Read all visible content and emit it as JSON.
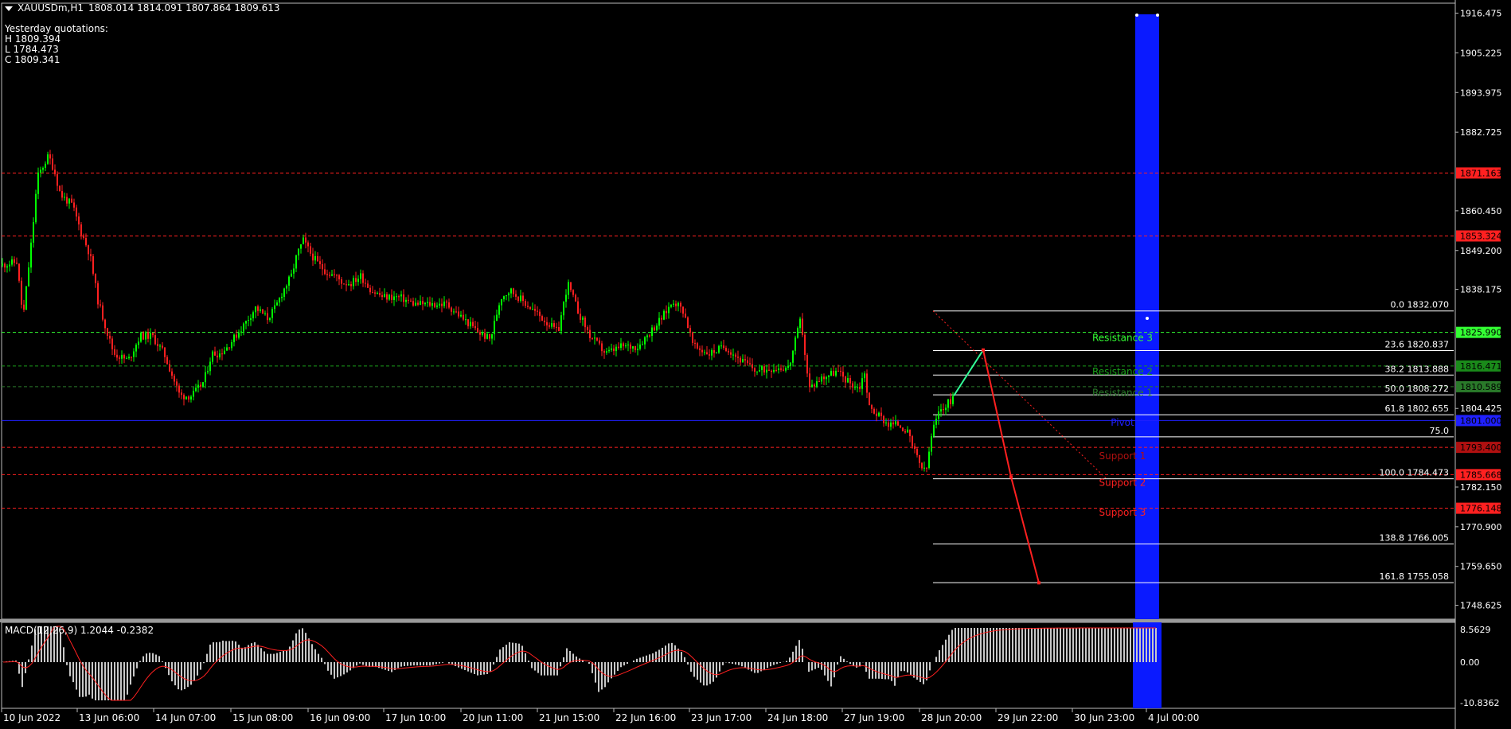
{
  "header": {
    "symbol": "XAUUSDm,H1",
    "ohlc": "1808.014 1814.091 1807.864 1809.613",
    "yesterday_title": "Yesterday quotations:",
    "yesterday_high": "H 1809.394",
    "yesterday_low": "L 1784.473",
    "yesterday_close": "C 1809.341"
  },
  "macd": {
    "label": "MACD(12,26,9) 1.2044 -0.2382",
    "scale_top": "8.5629",
    "scale_zero": "0.00",
    "scale_bottom": "-10.8362"
  },
  "chart_data": {
    "type": "candlestick",
    "price_axis": [
      "1916.475",
      "1905.225",
      "1893.975",
      "1882.725",
      "1871.163",
      "1860.450",
      "1853.324",
      "1849.200",
      "1838.175",
      "1825.990",
      "1816.471",
      "1810.589",
      "1804.425",
      "1801.000",
      "1793.400",
      "1785.668",
      "1782.150",
      "1776.148",
      "1770.900",
      "1759.650",
      "1748.625"
    ],
    "ylim": [
      1744.7,
      1919.3
    ],
    "time_axis": [
      "10 Jun 2022",
      "13 Jun 06:00",
      "14 Jun 07:00",
      "15 Jun 08:00",
      "16 Jun 09:00",
      "17 Jun 10:00",
      "20 Jun 11:00",
      "21 Jun 15:00",
      "22 Jun 16:00",
      "23 Jun 17:00",
      "24 Jun 18:00",
      "27 Jun 19:00",
      "28 Jun 20:00",
      "29 Jun 22:00",
      "30 Jun 23:00",
      "4 Jul 00:00"
    ],
    "price_path": [
      [
        0,
        1845
      ],
      [
        20,
        1846
      ],
      [
        28,
        1830
      ],
      [
        40,
        1855
      ],
      [
        46,
        1870
      ],
      [
        55,
        1874
      ],
      [
        60,
        1876
      ],
      [
        67,
        1872
      ],
      [
        75,
        1865
      ],
      [
        90,
        1862
      ],
      [
        100,
        1855
      ],
      [
        112,
        1848
      ],
      [
        122,
        1835
      ],
      [
        135,
        1825
      ],
      [
        142,
        1820
      ],
      [
        160,
        1818
      ],
      [
        175,
        1825
      ],
      [
        190,
        1825
      ],
      [
        205,
        1820
      ],
      [
        225,
        1808
      ],
      [
        240,
        1808
      ],
      [
        255,
        1812
      ],
      [
        265,
        1820
      ],
      [
        275,
        1820
      ],
      [
        285,
        1822
      ],
      [
        295,
        1825
      ],
      [
        305,
        1828
      ],
      [
        320,
        1833
      ],
      [
        335,
        1830
      ],
      [
        345,
        1833
      ],
      [
        355,
        1838
      ],
      [
        365,
        1842
      ],
      [
        372,
        1848
      ],
      [
        380,
        1852
      ],
      [
        390,
        1848
      ],
      [
        400,
        1845
      ],
      [
        410,
        1843
      ],
      [
        420,
        1842
      ],
      [
        430,
        1840
      ],
      [
        440,
        1840
      ],
      [
        452,
        1842
      ],
      [
        465,
        1838
      ],
      [
        480,
        1836
      ],
      [
        500,
        1836
      ],
      [
        520,
        1834
      ],
      [
        540,
        1834
      ],
      [
        560,
        1834
      ],
      [
        580,
        1830
      ],
      [
        600,
        1826
      ],
      [
        615,
        1824
      ],
      [
        628,
        1836
      ],
      [
        640,
        1838
      ],
      [
        660,
        1834
      ],
      [
        680,
        1830
      ],
      [
        700,
        1826
      ],
      [
        712,
        1840
      ],
      [
        725,
        1832
      ],
      [
        740,
        1825
      ],
      [
        760,
        1820
      ],
      [
        780,
        1822
      ],
      [
        800,
        1822
      ],
      [
        815,
        1826
      ],
      [
        830,
        1830
      ],
      [
        845,
        1835
      ],
      [
        858,
        1832
      ],
      [
        870,
        1822
      ],
      [
        890,
        1820
      ],
      [
        910,
        1822
      ],
      [
        930,
        1818
      ],
      [
        950,
        1815
      ],
      [
        970,
        1816
      ],
      [
        990,
        1816
      ],
      [
        1005,
        1830
      ],
      [
        1015,
        1810
      ],
      [
        1030,
        1813
      ],
      [
        1050,
        1815
      ],
      [
        1065,
        1812
      ],
      [
        1078,
        1810
      ],
      [
        1085,
        1815
      ],
      [
        1090,
        1805
      ],
      [
        1100,
        1803
      ],
      [
        1115,
        1800
      ],
      [
        1128,
        1800
      ],
      [
        1138,
        1798
      ],
      [
        1148,
        1792
      ],
      [
        1156,
        1788
      ],
      [
        1162,
        1786
      ],
      [
        1170,
        1798
      ],
      [
        1180,
        1804
      ],
      [
        1190,
        1806
      ],
      [
        1198,
        1808
      ]
    ],
    "horizontal_levels": [
      {
        "price": "1871.163",
        "color": "#ff2020",
        "style": "dash"
      },
      {
        "price": "1853.324",
        "color": "#ff2020",
        "style": "dash"
      },
      {
        "price": "1825.990",
        "color": "#33ff33",
        "style": "dash"
      },
      {
        "price": "1816.471",
        "color": "#1a9e1a",
        "style": "dash"
      },
      {
        "price": "1810.589",
        "color": "#2a7a2a",
        "style": "dash"
      },
      {
        "price": "1801.000",
        "color": "#2020ff",
        "style": "solid"
      },
      {
        "price": "1793.400",
        "color": "#ff2020",
        "style": "dash"
      },
      {
        "price": "1785.668",
        "color": "#ff2020",
        "style": "dash"
      },
      {
        "price": "1776.148",
        "color": "#ff2020",
        "style": "dash"
      }
    ],
    "fib_levels": [
      {
        "label": "0.0 1832.070",
        "price": 1832.07
      },
      {
        "label": "23.6 1820.837",
        "price": 1820.837
      },
      {
        "label": "38.2 1813.888",
        "price": 1813.888
      },
      {
        "label": "50.0 1808.272",
        "price": 1808.272
      },
      {
        "label": "61.8 1802.655",
        "price": 1802.655
      },
      {
        "label": "75.0",
        "price": 1796.4
      },
      {
        "label": "100.0 1784.473",
        "price": 1784.473
      },
      {
        "label": "138.8 1766.005",
        "price": 1766.005
      },
      {
        "label": "161.8 1755.058",
        "price": 1755.058
      }
    ],
    "pivot_labels": [
      {
        "text": "Resistance 3",
        "color": "#33ff33",
        "price": 1823.5
      },
      {
        "text": "Resistance 2",
        "color": "#1a9e1a",
        "price": 1814.0
      },
      {
        "text": "Resistance 1",
        "color": "#2a7a2a",
        "price": 1808.0
      },
      {
        "text": "Pivot",
        "color": "#2020ff",
        "price": 1799.5
      },
      {
        "text": "Support 1",
        "color": "#b01010",
        "price": 1790.0
      },
      {
        "text": "Support 2",
        "color": "#ff2020",
        "price": 1782.5
      },
      {
        "text": "Support 3",
        "color": "#ff2020",
        "price": 1774.0
      }
    ],
    "price_tags": [
      {
        "price": "1871.163",
        "bg": "#ff2020"
      },
      {
        "price": "1853.324",
        "bg": "#ff2020"
      },
      {
        "price": "1825.990",
        "bg": "#33ff33"
      },
      {
        "price": "1816.471",
        "bg": "#1a8a1a"
      },
      {
        "price": "1810.589",
        "bg": "#2a7a2a"
      },
      {
        "price": "1801.000",
        "bg": "#2020ff"
      },
      {
        "price": "1793.400",
        "bg": "#b01010"
      },
      {
        "price": "1785.668",
        "bg": "#ff2020"
      },
      {
        "price": "1776.148",
        "bg": "#ff2020"
      }
    ],
    "projection": {
      "green_line": [
        [
          1198,
          1808
        ],
        [
          1235,
          1821
        ]
      ],
      "red_line": [
        [
          1235,
          1821
        ],
        [
          1270,
          1785
        ],
        [
          1305,
          1755
        ]
      ]
    },
    "colors": {
      "bull": "#00ff00",
      "bear": "#ff2020",
      "highlight": "#0a1aff",
      "macd_hist": "#c8c8c8",
      "macd_signal": "#ff2020",
      "fib": "#ffffff"
    }
  }
}
